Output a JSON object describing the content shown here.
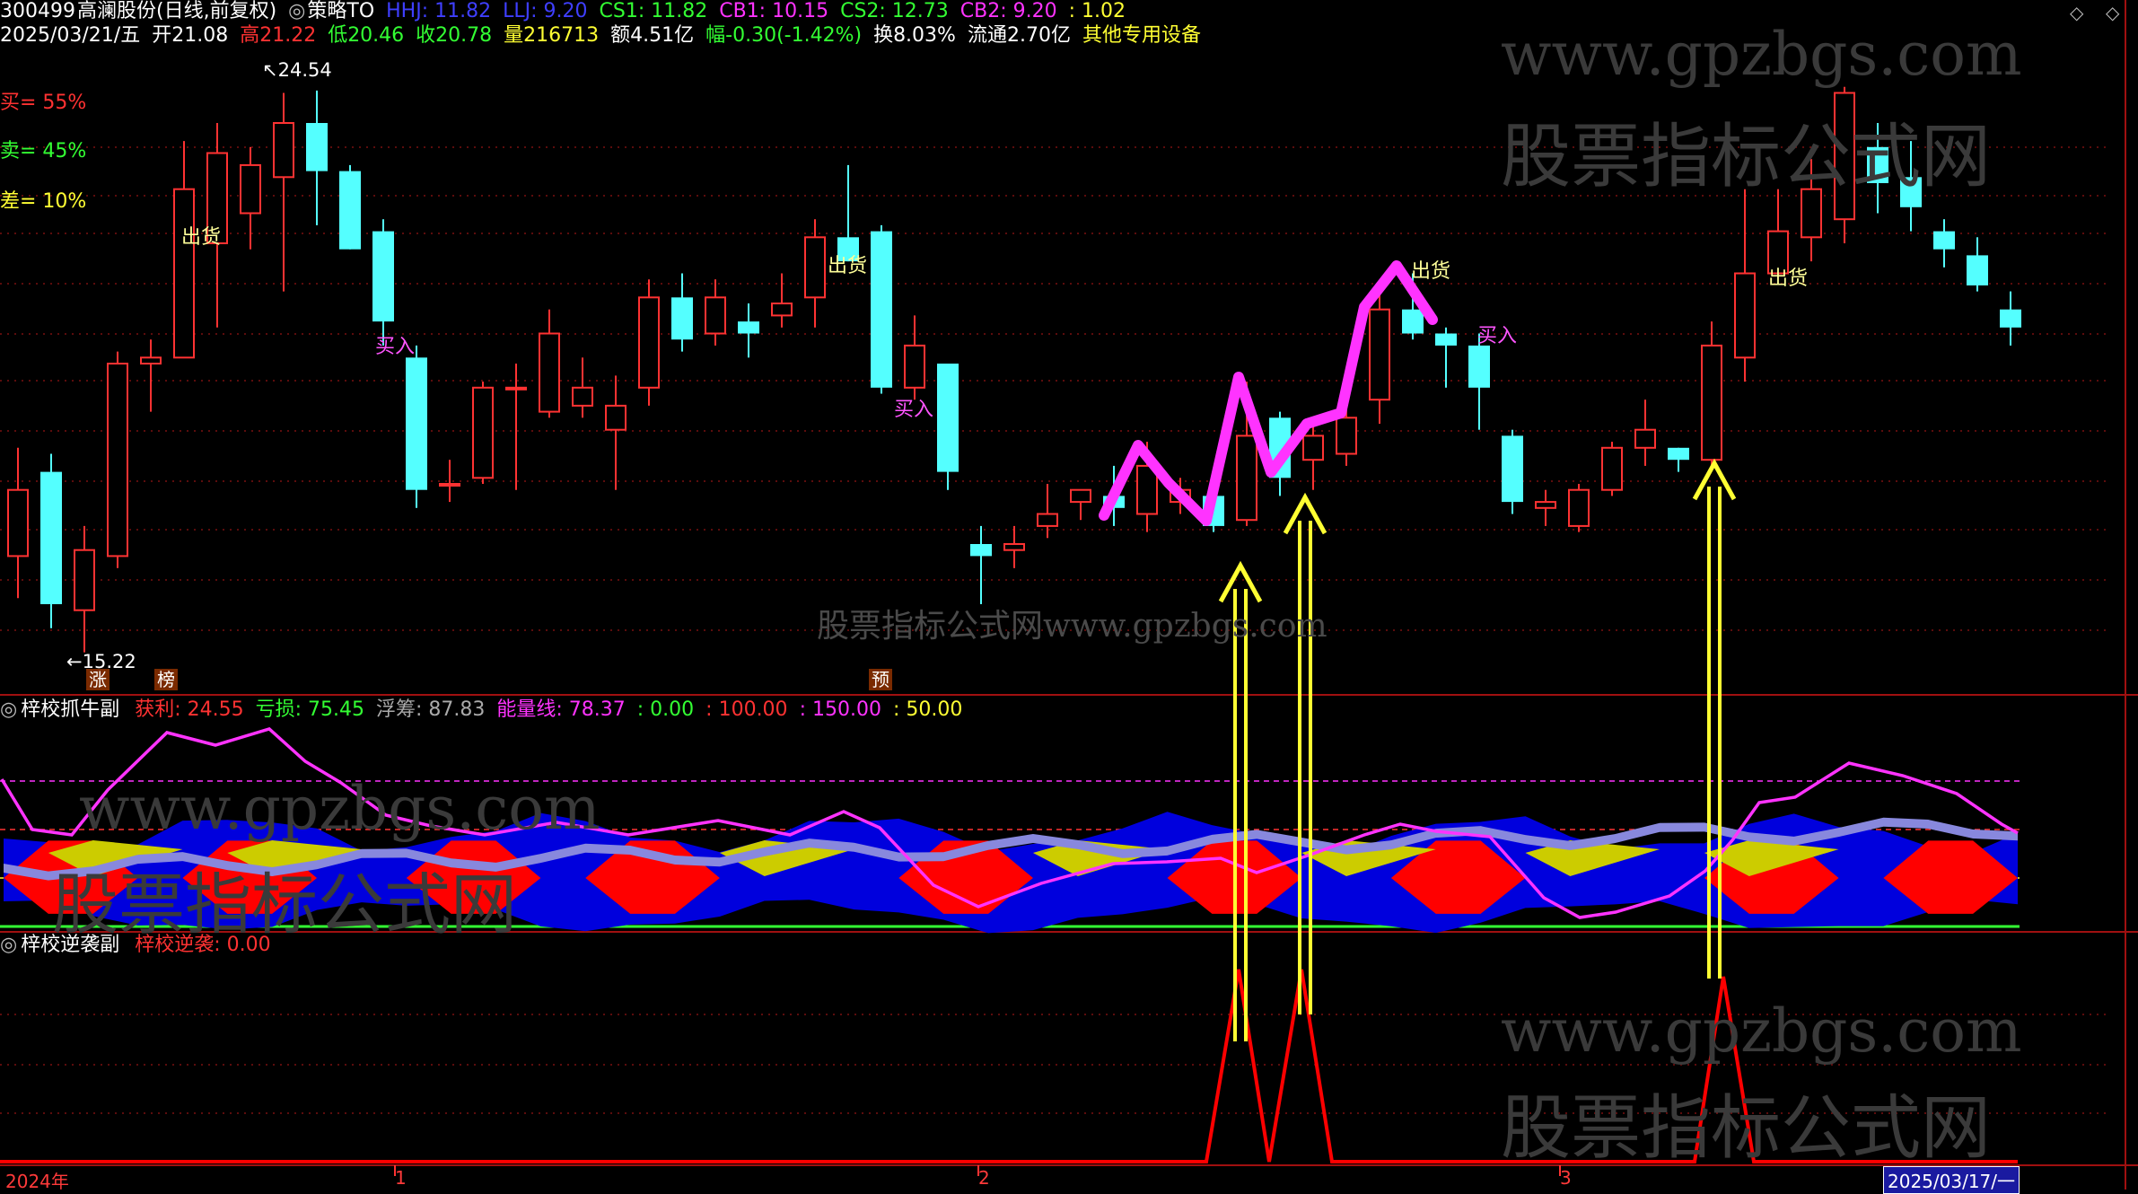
{
  "header": {
    "code": "300499",
    "name": "高澜股份",
    "period": "(日线,前复权)",
    "strategy_glyph": "◎",
    "strategy": "策略TO",
    "hhj": "HHJ: 11.82",
    "llj": "LLJ: 9.20",
    "cs1": "CS1: 11.82",
    "cb1": "CB1: 10.15",
    "cs2": "CS2: 12.73",
    "cb2": "CB2: 9.20",
    "ratio": ": 1.02",
    "date": "2025/03/21/五",
    "open": "开21.08",
    "high": "高21.22",
    "low": "低20.46",
    "close": "收20.78",
    "vol": "量216713",
    "amount": "额4.51亿",
    "change": "幅-0.30(-1.42%)",
    "turnover": "换8.03%",
    "float": "流通2.70亿",
    "sector": "其他专用设备"
  },
  "side": {
    "buy": "买= 55%",
    "sell": "卖= 45%",
    "diff": "差= 10%"
  },
  "price_marks": {
    "high": "24.54",
    "low": "15.22"
  },
  "annotations": {
    "sell1": "出货",
    "sell2": "出货",
    "sell3": "出货",
    "sell4": "出货",
    "buy1": "买入",
    "buy2": "买入",
    "buy3": "买入"
  },
  "tags": {
    "zhang": "涨",
    "bang": "榜",
    "yu": "预"
  },
  "watermarks": {
    "url": "www.gpzbgs.com",
    "cn": "股票指标公式网",
    "mid": "股票指标公式网www.gpzbgs.com"
  },
  "panel2": {
    "icon": "◎",
    "name": "梓校抓牛副",
    "profit": "获利: 24.55",
    "loss": "亏损: 75.45",
    "float": "浮筹: 87.83",
    "energy": "能量线: 78.37",
    "v0": ": 0.00",
    "v100": ": 100.00",
    "v150": ": 150.00",
    "v50": ": 50.00"
  },
  "panel3": {
    "icon": "◎",
    "name": "梓校逆袭副",
    "value": "梓校逆袭: 0.00"
  },
  "xaxis": {
    "year": "2024年",
    "m1": "1",
    "m2": "2",
    "m3": "3",
    "date_box": "2025/03/17/一"
  },
  "colors": {
    "up": "#ff3232",
    "down": "#54ffff",
    "magenta": "#ff33ff",
    "yellow": "#ffff33",
    "blue": "#0000dd",
    "red": "#ff0000"
  },
  "candles": [
    [
      16.8,
      17.9,
      18.6,
      16.1
    ],
    [
      18.2,
      16.0,
      18.5,
      15.6
    ],
    [
      15.9,
      16.9,
      17.3,
      15.2
    ],
    [
      16.8,
      20.0,
      20.2,
      16.6
    ],
    [
      20.0,
      20.1,
      20.4,
      19.2
    ],
    [
      20.1,
      22.9,
      23.7,
      20.1
    ],
    [
      22.0,
      23.5,
      24.0,
      20.6
    ],
    [
      22.5,
      23.3,
      23.6,
      21.9
    ],
    [
      23.1,
      24.0,
      24.5,
      21.2
    ],
    [
      24.0,
      23.2,
      24.54,
      22.3
    ],
    [
      23.2,
      21.9,
      23.3,
      21.9
    ],
    [
      22.2,
      20.7,
      22.4,
      20.3
    ],
    [
      20.1,
      17.9,
      20.3,
      17.6
    ],
    [
      18.0,
      18.0,
      18.4,
      17.7
    ],
    [
      18.1,
      19.6,
      19.7,
      18.0
    ],
    [
      19.6,
      19.6,
      20.0,
      17.9
    ],
    [
      19.2,
      20.5,
      20.9,
      19.1
    ],
    [
      19.3,
      19.6,
      20.1,
      19.1
    ],
    [
      18.9,
      19.3,
      19.8,
      17.9
    ],
    [
      19.6,
      21.1,
      21.4,
      19.3
    ],
    [
      21.1,
      20.4,
      21.5,
      20.2
    ],
    [
      20.5,
      21.1,
      21.4,
      20.3
    ],
    [
      20.7,
      20.5,
      21.0,
      20.1
    ],
    [
      20.8,
      21.0,
      21.5,
      20.6
    ],
    [
      21.1,
      22.1,
      22.4,
      20.6
    ],
    [
      22.1,
      21.7,
      23.3,
      21.7
    ],
    [
      22.2,
      19.6,
      22.3,
      19.5
    ],
    [
      19.6,
      20.3,
      20.8,
      19.4
    ],
    [
      20.0,
      18.2,
      20.0,
      17.9
    ],
    [
      17.0,
      16.8,
      17.3,
      16.0
    ],
    [
      16.9,
      17.0,
      17.3,
      16.6
    ],
    [
      17.3,
      17.5,
      18.0,
      17.1
    ],
    [
      17.7,
      17.9,
      17.9,
      17.4
    ],
    [
      17.8,
      17.6,
      18.3,
      17.3
    ],
    [
      17.5,
      18.3,
      18.7,
      17.2
    ],
    [
      17.7,
      17.9,
      18.1,
      17.5
    ],
    [
      17.8,
      17.3,
      18.2,
      17.2
    ],
    [
      17.4,
      18.8,
      19.7,
      17.3
    ],
    [
      19.1,
      18.1,
      19.2,
      17.8
    ],
    [
      18.4,
      18.8,
      19.0,
      17.9
    ],
    [
      18.5,
      19.1,
      19.4,
      18.3
    ],
    [
      19.4,
      20.9,
      21.2,
      19.0
    ],
    [
      20.9,
      20.5,
      21.5,
      20.4
    ],
    [
      20.5,
      20.3,
      20.6,
      19.6
    ],
    [
      20.3,
      19.6,
      20.5,
      18.9
    ],
    [
      18.8,
      17.7,
      18.9,
      17.5
    ],
    [
      17.6,
      17.7,
      17.9,
      17.3
    ],
    [
      17.3,
      17.9,
      18.0,
      17.2
    ],
    [
      17.9,
      18.6,
      18.7,
      17.8
    ],
    [
      18.6,
      18.9,
      19.4,
      18.3
    ],
    [
      18.6,
      18.4,
      18.6,
      18.2
    ],
    [
      18.4,
      20.3,
      20.7,
      18.3
    ],
    [
      20.1,
      21.5,
      22.9,
      19.7
    ],
    [
      21.5,
      22.2,
      22.9,
      21.6
    ],
    [
      22.1,
      22.9,
      23.4,
      21.7
    ],
    [
      22.4,
      24.5,
      24.6,
      22.0
    ],
    [
      23.6,
      23.0,
      24.0,
      22.5
    ],
    [
      23.1,
      22.6,
      23.7,
      22.2
    ],
    [
      22.2,
      21.9,
      22.4,
      21.6
    ],
    [
      21.8,
      21.3,
      22.1,
      21.2
    ],
    [
      20.9,
      20.6,
      21.2,
      20.3
    ]
  ]
}
